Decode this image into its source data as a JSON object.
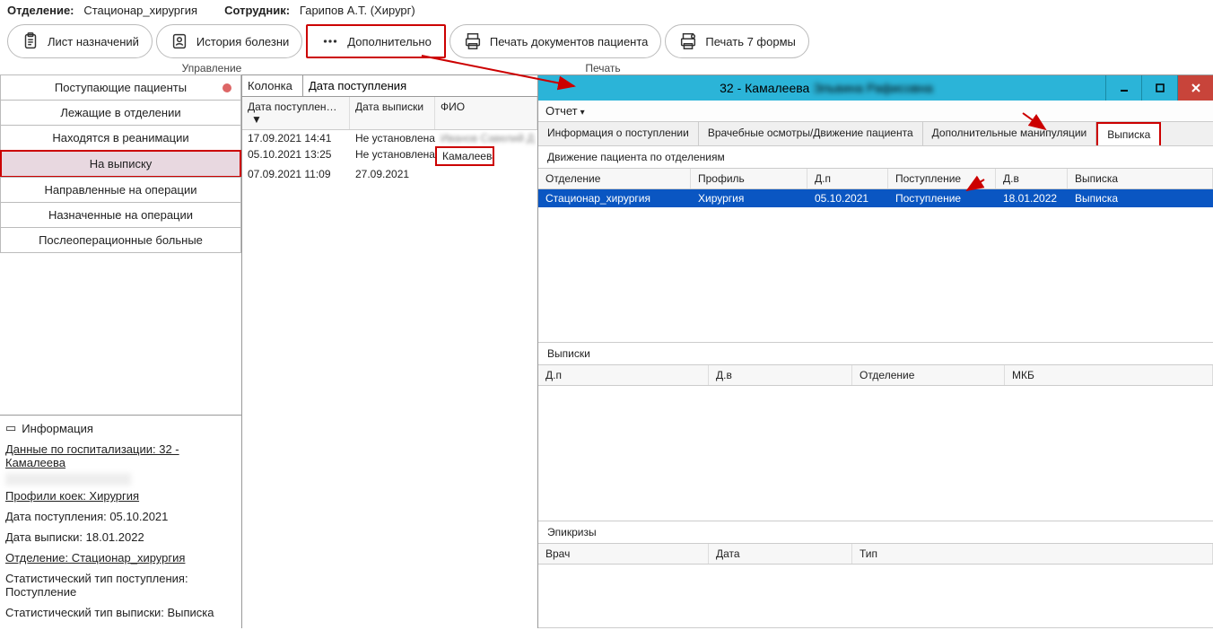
{
  "header": {
    "dept_label": "Отделение:",
    "dept_value": "Стационар_хирургия",
    "emp_label": "Сотрудник:",
    "emp_value": "Гарипов А.Т. (Хирург)"
  },
  "toolbar": {
    "assign": "Лист назначений",
    "history": "История болезни",
    "more": "Дополнительно",
    "printdocs": "Печать документов пациента",
    "print7": "Печать 7 формы"
  },
  "sections": {
    "management": "Управление",
    "print": "Печать"
  },
  "sidebar": {
    "items": [
      {
        "label": "Поступающие пациенты"
      },
      {
        "label": "Лежащие в отделении"
      },
      {
        "label": "Находятся в реанимации"
      },
      {
        "label": "На выписку"
      },
      {
        "label": "Направленные на операции"
      },
      {
        "label": "Назначенные на операции"
      },
      {
        "label": "Послеоперационные больные"
      }
    ],
    "active_index": 3
  },
  "info": {
    "title": "Информация",
    "hosp": "Данные по госпитализации: 32 - Камалеева",
    "profiles": "Профили коек: Хирургия",
    "admit": "Дата поступления: 05.10.2021",
    "discharge": "Дата выписки: 18.01.2022",
    "dept": "Отделение: Стационар_хирургия",
    "stat_in": "Статистический тип поступления: Поступление",
    "stat_out": "Статистический тип выписки: Выписка"
  },
  "center": {
    "column_label": "Колонка",
    "column_value": "Дата поступления",
    "headers": {
      "c1": "Дата поступлен…",
      "c2": "Дата выписки",
      "c3": "ФИО"
    },
    "rows": [
      {
        "c1": "17.09.2021 14:41",
        "c2": "Не установлена",
        "c3": ""
      },
      {
        "c1": "05.10.2021 13:25",
        "c2": "Не установлена",
        "c3": "Камалеева"
      },
      {
        "c1": "07.09.2021 11:09",
        "c2": "27.09.2021",
        "c3": ""
      }
    ]
  },
  "window": {
    "title_prefix": "32 - Камалеева ",
    "title_blur": "Эльвина Рафисовна",
    "report_label": "Отчет"
  },
  "tabs": {
    "t1": "Информация о поступлении",
    "t2": "Врачебные осмотры/Движение пациента",
    "t3": "Дополнительные манипуляции",
    "t4": "Выписка"
  },
  "movement": {
    "title": "Движение пациента по отделениям",
    "headers": {
      "h1": "Отделение",
      "h2": "Профиль",
      "h3": "Д.п",
      "h4": "Поступление",
      "h5": "Д.в",
      "h6": "Выписка"
    },
    "row": {
      "c1": "Стационар_хирургия",
      "c2": "Хирургия",
      "c3": "05.10.2021",
      "c4": "Поступление",
      "c5": "18.01.2022",
      "c6": "Выписка"
    }
  },
  "discharges": {
    "title": "Выписки",
    "headers": {
      "h1": "Д.п",
      "h2": "Д.в",
      "h3": "Отделение",
      "h4": "МКБ"
    }
  },
  "epicrises": {
    "title": "Эпикризы",
    "headers": {
      "h1": "Врач",
      "h2": "Дата",
      "h3": "Тип"
    }
  }
}
